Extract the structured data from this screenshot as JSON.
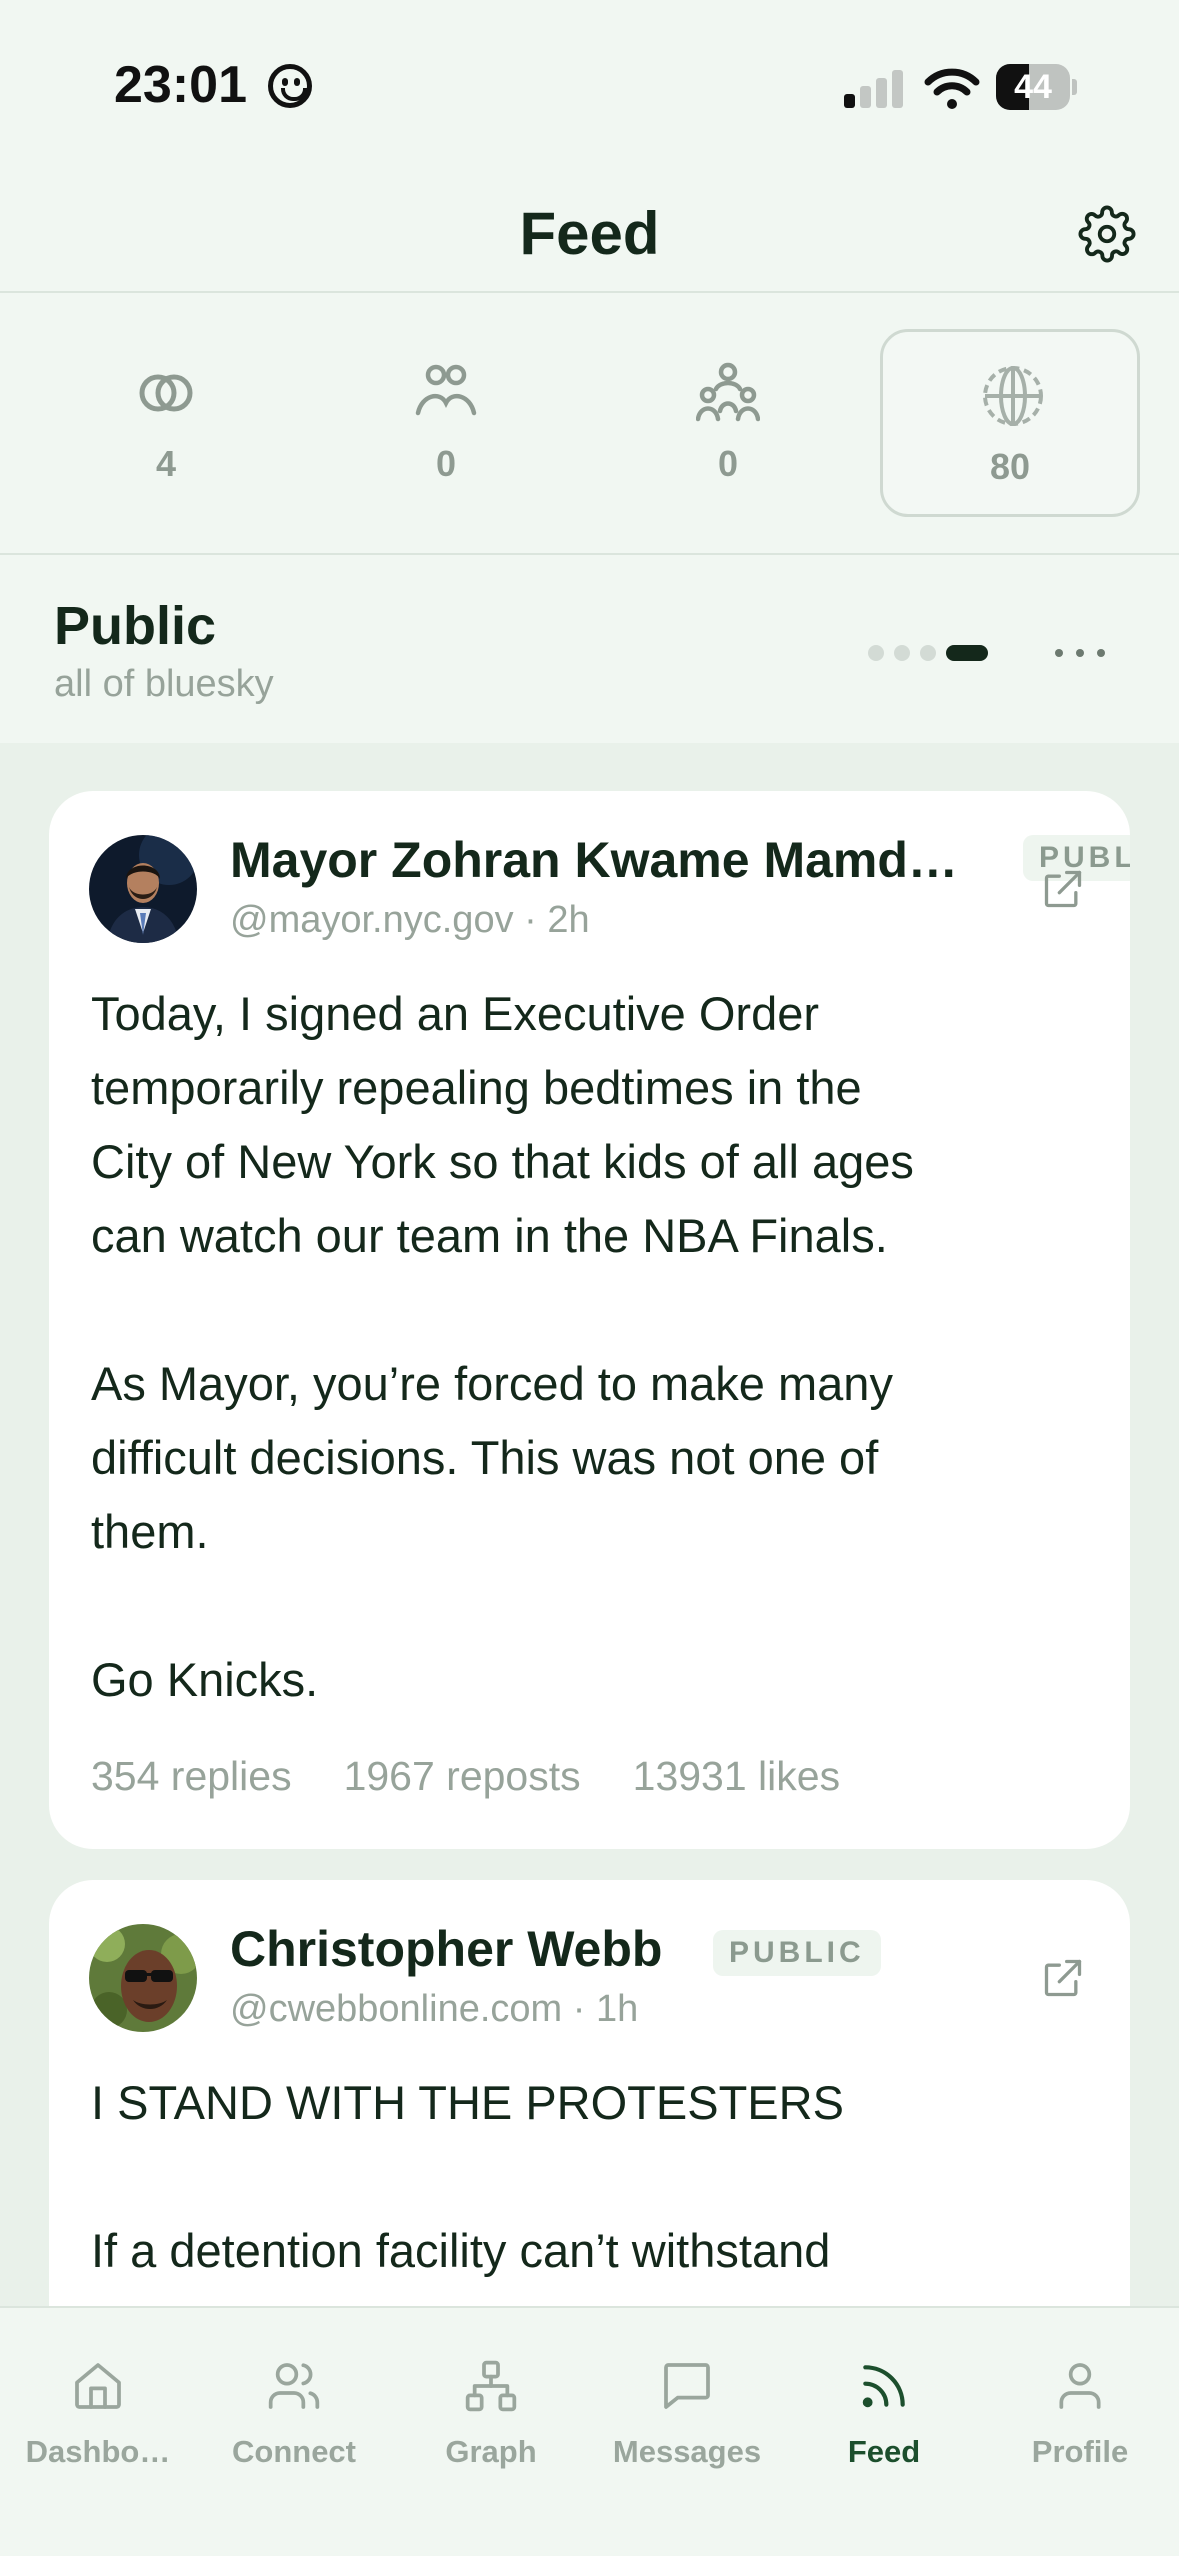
{
  "status_bar": {
    "time": "23:01",
    "battery": "44",
    "battery_level": 0.44
  },
  "header": {
    "title": "Feed"
  },
  "circle_tabs": [
    {
      "name": "overlap",
      "count": "4",
      "active": false
    },
    {
      "name": "pair",
      "count": "0",
      "active": false
    },
    {
      "name": "group",
      "count": "0",
      "active": false
    },
    {
      "name": "globe",
      "count": "80",
      "active": true
    }
  ],
  "feed": {
    "name": "Public",
    "subtitle": "all of bluesky",
    "page_count": 4,
    "current_page": 4
  },
  "posts": [
    {
      "author": "Mayor Zohran Kwame Mamd…",
      "handle": "@mayor.nyc.gov · 2h",
      "badge": "PUBLIC",
      "text": "Today, I signed an Executive Order\ntemporarily repealing bedtimes in the\nCity of New York so that kids of all ages\ncan watch our team in the NBA Finals.\n\nAs Mayor, you’re forced to make many\ndifficult decisions. This was not one of\nthem.\n\nGo Knicks.",
      "replies": "354 replies",
      "reposts": "1967 reposts",
      "likes": "13931 likes"
    },
    {
      "author": "Christopher Webb",
      "handle": "@cwebbonline.com · 1h",
      "badge": "PUBLIC",
      "text": "I STAND WITH THE PROTESTERS\n\nIf a detention facility can’t withstand"
    }
  ],
  "bottom_nav": [
    {
      "label": "Dashbo…",
      "icon": "home-icon",
      "active": false
    },
    {
      "label": "Connect",
      "icon": "users-icon",
      "active": false
    },
    {
      "label": "Graph",
      "icon": "network-icon",
      "active": false
    },
    {
      "label": "Messages",
      "icon": "message-icon",
      "active": false
    },
    {
      "label": "Feed",
      "icon": "rss-icon",
      "active": true
    },
    {
      "label": "Profile",
      "icon": "user-icon",
      "active": false
    }
  ],
  "colors": {
    "background": "#e9f1ea",
    "header_background": "#f1f7f2",
    "text": "#14281b",
    "muted": "#97a39a",
    "accent": "#1c4f2d"
  }
}
